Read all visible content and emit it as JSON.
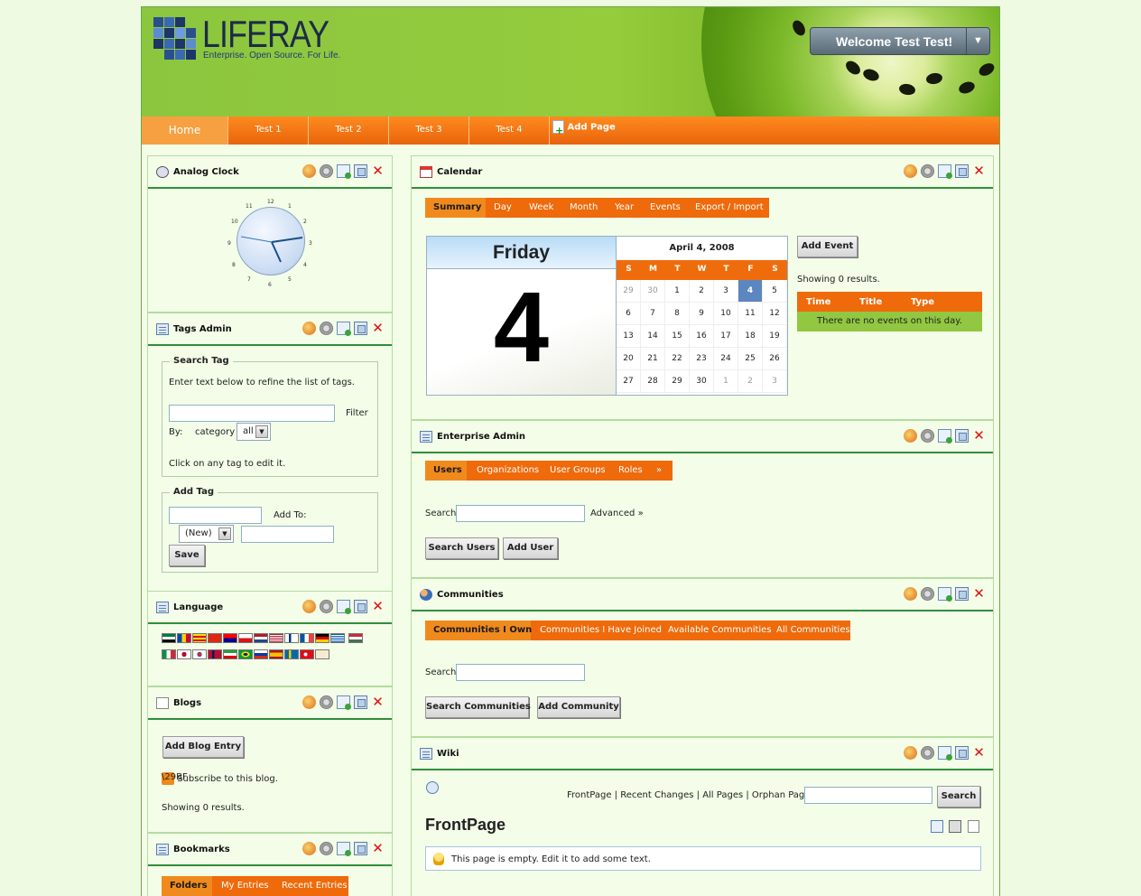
{
  "header": {
    "logo_word": "LIFERAY",
    "logo_tagline": "Enterprise. Open Source. For Life.",
    "welcome_label": "Welcome Test Test!",
    "welcome_arrow": "▼"
  },
  "nav": {
    "tabs": [
      "Home",
      "Test 1",
      "Test 2",
      "Test 3",
      "Test 4"
    ],
    "active_tab": "Home",
    "add_page_label": "Add Page"
  },
  "portlets": {
    "analog_clock": {
      "title": "Analog Clock",
      "numbers": [
        "12",
        "1",
        "2",
        "3",
        "4",
        "5",
        "6",
        "7",
        "8",
        "9",
        "10",
        "11"
      ]
    },
    "tags_admin": {
      "title": "Tags Admin",
      "search_legend": "Search Tag",
      "search_hint": "Enter text below to refine the list of tags.",
      "filter_label": "Filter",
      "by_label": "By:",
      "category_label": "category",
      "category_value": "all",
      "click_hint": "Click on any tag to edit it.",
      "add_legend": "Add Tag",
      "add_to_label": "Add To:",
      "new_value": "(New)",
      "save_label": "Save"
    },
    "language": {
      "title": "Language"
    },
    "blogs": {
      "title": "Blogs",
      "add_entry_label": "Add Blog Entry",
      "subscribe_label": "Subscribe to this blog.",
      "results_label": "Showing 0 results."
    },
    "bookmarks": {
      "title": "Bookmarks",
      "tabs": [
        "Folders",
        "My Entries",
        "Recent Entries"
      ]
    },
    "calendar": {
      "title": "Calendar",
      "tabs": [
        "Summary",
        "Day",
        "Week",
        "Month",
        "Year",
        "Events",
        "Export / Import"
      ],
      "weekday": "Friday",
      "day_number": "4",
      "month_title": "April 4, 2008",
      "dow": [
        "S",
        "M",
        "T",
        "W",
        "T",
        "F",
        "S"
      ],
      "days": [
        [
          "29",
          "30",
          "1",
          "2",
          "3",
          "4",
          "5"
        ],
        [
          "6",
          "7",
          "8",
          "9",
          "10",
          "11",
          "12"
        ],
        [
          "13",
          "14",
          "15",
          "16",
          "17",
          "18",
          "19"
        ],
        [
          "20",
          "21",
          "22",
          "23",
          "24",
          "25",
          "26"
        ],
        [
          "27",
          "28",
          "29",
          "30",
          "1",
          "2",
          "3"
        ]
      ],
      "add_event_label": "Add Event",
      "results_label": "Showing 0 results.",
      "columns": [
        "Time",
        "Title",
        "Type"
      ],
      "empty_message": "There are no events on this day."
    },
    "enterprise_admin": {
      "title": "Enterprise Admin",
      "tabs": [
        "Users",
        "Organizations",
        "User Groups",
        "Roles",
        "»"
      ],
      "search_label": "Search",
      "advanced_label": "Advanced »",
      "search_button": "Search Users",
      "add_button": "Add User"
    },
    "communities": {
      "title": "Communities",
      "tabs": [
        "Communities I Own",
        "Communities I Have Joined",
        "Available Communities",
        "All Communities"
      ],
      "search_label": "Search",
      "search_button": "Search Communities",
      "add_button": "Add Community"
    },
    "wiki": {
      "title": "Wiki",
      "links": "FrontPage | Recent Changes | All Pages | Orphan Pages",
      "search_button": "Search",
      "page_title": "FrontPage",
      "empty_message": "This page is empty. Edit it to add some text."
    }
  },
  "colors": {
    "header_green": "#8cc63f",
    "nav_orange": "#ee6a0b",
    "portlet_bg": "#f3fde8",
    "today_blue": "#5c86c0",
    "event_green": "#92c742"
  }
}
